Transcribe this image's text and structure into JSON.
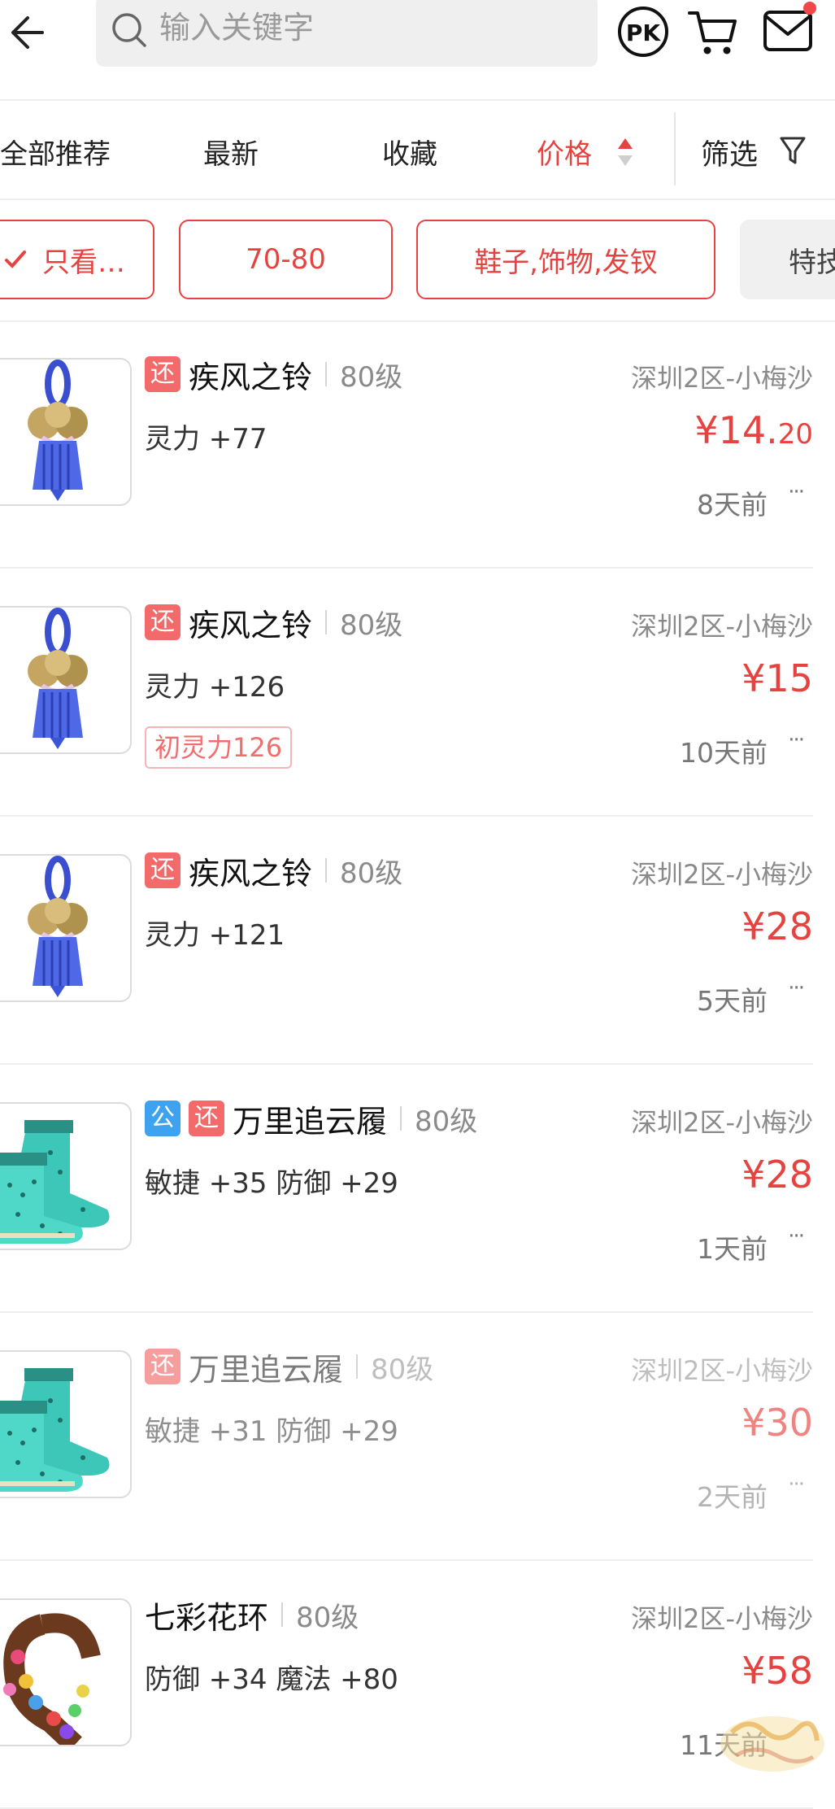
{
  "header": {
    "search_placeholder": "输入关键字",
    "pk_label": "PK"
  },
  "sort_bar": {
    "items": [
      "全部推荐",
      "最新",
      "收藏",
      "价格"
    ],
    "active": "价格",
    "filter_label": "筛选"
  },
  "chips": [
    "只看…",
    "70-80",
    "鞋子,饰物,发钗",
    "特技"
  ],
  "items": [
    {
      "tags": [
        "还"
      ],
      "name": "疾风之铃",
      "level": "80级",
      "server": "深圳2区-小梅沙",
      "attrs": "灵力 +77",
      "price_main": "¥14.",
      "price_cents": "20",
      "badge": "",
      "time": "8天前",
      "more": "···",
      "dim": false,
      "image": "bell-icon"
    },
    {
      "tags": [
        "还"
      ],
      "name": "疾风之铃",
      "level": "80级",
      "server": "深圳2区-小梅沙",
      "attrs": "灵力 +126",
      "price_main": "¥15",
      "price_cents": "",
      "badge": "初灵力126",
      "time": "10天前",
      "more": "···",
      "dim": false,
      "image": "bell-icon"
    },
    {
      "tags": [
        "还"
      ],
      "name": "疾风之铃",
      "level": "80级",
      "server": "深圳2区-小梅沙",
      "attrs": "灵力 +121",
      "price_main": "¥28",
      "price_cents": "",
      "badge": "",
      "time": "5天前",
      "more": "···",
      "dim": false,
      "image": "bell-icon"
    },
    {
      "tags": [
        "公",
        "还"
      ],
      "name": "万里追云履",
      "level": "80级",
      "server": "深圳2区-小梅沙",
      "attrs": "敏捷 +35 防御 +29",
      "price_main": "¥28",
      "price_cents": "",
      "badge": "",
      "time": "1天前",
      "more": "···",
      "dim": false,
      "image": "boots-icon"
    },
    {
      "tags": [
        "还"
      ],
      "name": "万里追云履",
      "level": "80级",
      "server": "深圳2区-小梅沙",
      "attrs": "敏捷 +31 防御 +29",
      "price_main": "¥30",
      "price_cents": "",
      "badge": "",
      "time": "2天前",
      "more": "···",
      "dim": true,
      "image": "boots-icon"
    },
    {
      "tags": [],
      "name": "七彩花环",
      "level": "80级",
      "server": "深圳2区-小梅沙",
      "attrs": "防御 +34 魔法 +80",
      "price_main": "¥58",
      "price_cents": "",
      "badge": "",
      "time": "11天前",
      "more": "",
      "dim": false,
      "image": "flower-wreath-icon"
    }
  ],
  "colors": {
    "accent": "#e64340",
    "tag_huan": "#f26a6a",
    "tag_gong": "#3ea2ef"
  }
}
